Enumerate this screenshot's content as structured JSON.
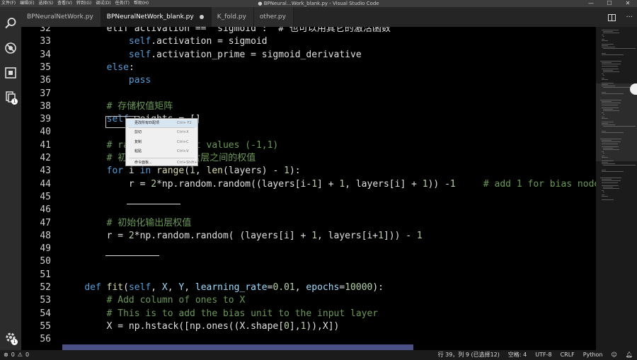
{
  "window": {
    "title": "● BPNeural…Work_blank.py - Visual Studio Code",
    "menu": [
      "文件(F)",
      "编辑(E)",
      "选择(S)",
      "查看(V)",
      "转到(G)",
      "调试(D)",
      "任务(T)",
      "帮助(H)"
    ],
    "controls": [
      "—",
      "☐",
      "✕"
    ]
  },
  "activity_bar": {
    "icons": [
      "search-icon",
      "debug-icon",
      "extensions-icon",
      "explorer-icon",
      "settings-icon"
    ],
    "badge": "1"
  },
  "tabs": [
    {
      "label": "BPNeuralNetWork.py",
      "active": false,
      "dirty": false
    },
    {
      "label": "BPNeuralNetWork_blank.py",
      "active": true,
      "dirty": true
    },
    {
      "label": "K_fold.py",
      "active": false,
      "dirty": false
    },
    {
      "label": "other.py",
      "active": false,
      "dirty": false
    }
  ],
  "tab_actions": [
    "split-editor-icon",
    "more-icon"
  ],
  "editor": {
    "lines": [
      {
        "n": "32",
        "segs": [
          [
            "        elif activation == 'sigmoid':  # 也可以用其它的激活函数",
            ""
          ]
        ]
      },
      {
        "n": "33",
        "segs": [
          [
            "            ",
            ""
          ],
          [
            "self",
            "self"
          ],
          [
            ".activation = sigmoid",
            ""
          ]
        ]
      },
      {
        "n": "34",
        "segs": [
          [
            "            ",
            ""
          ],
          [
            "self",
            "self"
          ],
          [
            ".activation_prime = sigmoid_derivative",
            ""
          ]
        ]
      },
      {
        "n": "35",
        "segs": [
          [
            "        ",
            ""
          ],
          [
            "else",
            "kw"
          ],
          [
            ":",
            ""
          ]
        ]
      },
      {
        "n": "36",
        "segs": [
          [
            "            ",
            ""
          ],
          [
            "pass",
            "kw"
          ]
        ]
      },
      {
        "n": "37",
        "segs": [
          [
            "",
            ""
          ]
        ]
      },
      {
        "n": "38",
        "segs": [
          [
            "        ",
            ""
          ],
          [
            "# 存储权值矩阵",
            "cm"
          ]
        ]
      },
      {
        "n": "39",
        "segs": [
          [
            "        ",
            ""
          ],
          [
            "self",
            "self"
          ],
          [
            ".weights = []",
            ""
          ]
        ]
      },
      {
        "n": "40",
        "segs": [
          [
            "",
            ""
          ]
        ]
      },
      {
        "n": "41",
        "segs": [
          [
            "        ",
            ""
          ],
          [
            "# range of weight values (-1,1)",
            "cm"
          ]
        ]
      },
      {
        "n": "42",
        "segs": [
          [
            "        ",
            ""
          ],
          [
            "# 初始化输入层和隐含层之间的权值",
            "cm"
          ]
        ]
      },
      {
        "n": "43",
        "segs": [
          [
            "        ",
            ""
          ],
          [
            "for",
            "kw"
          ],
          [
            " i ",
            ""
          ],
          [
            "in",
            "kw"
          ],
          [
            " ",
            ""
          ],
          [
            "range",
            "fn"
          ],
          [
            "(",
            ""
          ],
          [
            "1",
            "num"
          ],
          [
            ", ",
            ""
          ],
          [
            "len",
            "fn"
          ],
          [
            "(layers) - ",
            ""
          ],
          [
            "1",
            "num"
          ],
          [
            "):",
            ""
          ]
        ]
      },
      {
        "n": "44",
        "segs": [
          [
            "            r = ",
            ""
          ],
          [
            "2",
            "num"
          ],
          [
            "*np.random.random((layers[i-",
            ""
          ],
          [
            "1",
            "num"
          ],
          [
            "] + ",
            ""
          ],
          [
            "1",
            "num"
          ],
          [
            ", layers[i] + ",
            ""
          ],
          [
            "1",
            "num"
          ],
          [
            ")) -",
            ""
          ],
          [
            "1",
            "num"
          ],
          [
            "     ",
            ""
          ],
          [
            "# add 1 for bias node",
            "cm"
          ]
        ]
      },
      {
        "n": "45",
        "segs": [
          [
            "",
            ""
          ]
        ]
      },
      {
        "n": "46",
        "segs": [
          [
            "",
            ""
          ]
        ]
      },
      {
        "n": "47",
        "segs": [
          [
            "        ",
            ""
          ],
          [
            "# 初始化输出层权值",
            "cm"
          ]
        ]
      },
      {
        "n": "48",
        "segs": [
          [
            "        r = ",
            ""
          ],
          [
            "2",
            "num"
          ],
          [
            "*np.random.random( (layers[i] + ",
            ""
          ],
          [
            "1",
            "num"
          ],
          [
            ", layers[i+",
            ""
          ],
          [
            "1",
            "num"
          ],
          [
            "])) - ",
            ""
          ],
          [
            "1",
            "num"
          ]
        ]
      },
      {
        "n": "49",
        "segs": [
          [
            "",
            ""
          ]
        ]
      },
      {
        "n": "50",
        "segs": [
          [
            "",
            ""
          ]
        ]
      },
      {
        "n": "51",
        "segs": [
          [
            "",
            ""
          ]
        ]
      },
      {
        "n": "52",
        "segs": [
          [
            "    ",
            ""
          ],
          [
            "def",
            "kw"
          ],
          [
            " ",
            ""
          ],
          [
            "fit",
            "fn"
          ],
          [
            "(",
            ""
          ],
          [
            "self",
            "self"
          ],
          [
            ", ",
            ""
          ],
          [
            "X",
            "par"
          ],
          [
            ", ",
            ""
          ],
          [
            "Y",
            "par"
          ],
          [
            ", ",
            ""
          ],
          [
            "learning_rate",
            "par"
          ],
          [
            "=",
            ""
          ],
          [
            "0.01",
            "num"
          ],
          [
            ", ",
            ""
          ],
          [
            "epochs",
            "par"
          ],
          [
            "=",
            ""
          ],
          [
            "10000",
            "num"
          ],
          [
            "):",
            ""
          ]
        ]
      },
      {
        "n": "53",
        "segs": [
          [
            "        ",
            ""
          ],
          [
            "# Add column of ones to X",
            "cm"
          ]
        ]
      },
      {
        "n": "54",
        "segs": [
          [
            "        ",
            ""
          ],
          [
            "# This is to add the bias unit to the input layer",
            "cm"
          ]
        ]
      },
      {
        "n": "55",
        "segs": [
          [
            "        X = np.hstack([np.ones((X.shape[",
            ""
          ],
          [
            "0",
            "num"
          ],
          [
            "],",
            ""
          ],
          [
            "1",
            "num"
          ],
          [
            ")),X])",
            ""
          ]
        ]
      },
      {
        "n": "56",
        "segs": [
          [
            "",
            ""
          ]
        ]
      }
    ]
  },
  "context_menu": {
    "items": [
      {
        "label": "更改所有匹配项",
        "key": "Ctrl+ F2",
        "highlighted": true
      },
      {
        "label": "剪切",
        "key": "Ctrl+X",
        "highlighted": false
      },
      {
        "label": "复制",
        "key": "Ctrl+C",
        "highlighted": false
      },
      {
        "label": "粘贴",
        "key": "Ctrl+V",
        "highlighted": false
      },
      {
        "label": "命令面板...",
        "key": "Ctrl+Shift+P",
        "highlighted": false
      }
    ]
  },
  "status_bar": {
    "errors": "0",
    "warnings": "0",
    "position": "行 39，列 9 (已选择12)",
    "spaces": "空格: 4",
    "encoding": "UTF-8",
    "eol": "CRLF",
    "language": "Python",
    "icons": [
      "error-icon",
      "warning-icon",
      "feedback-icon",
      "bell-icon"
    ]
  }
}
